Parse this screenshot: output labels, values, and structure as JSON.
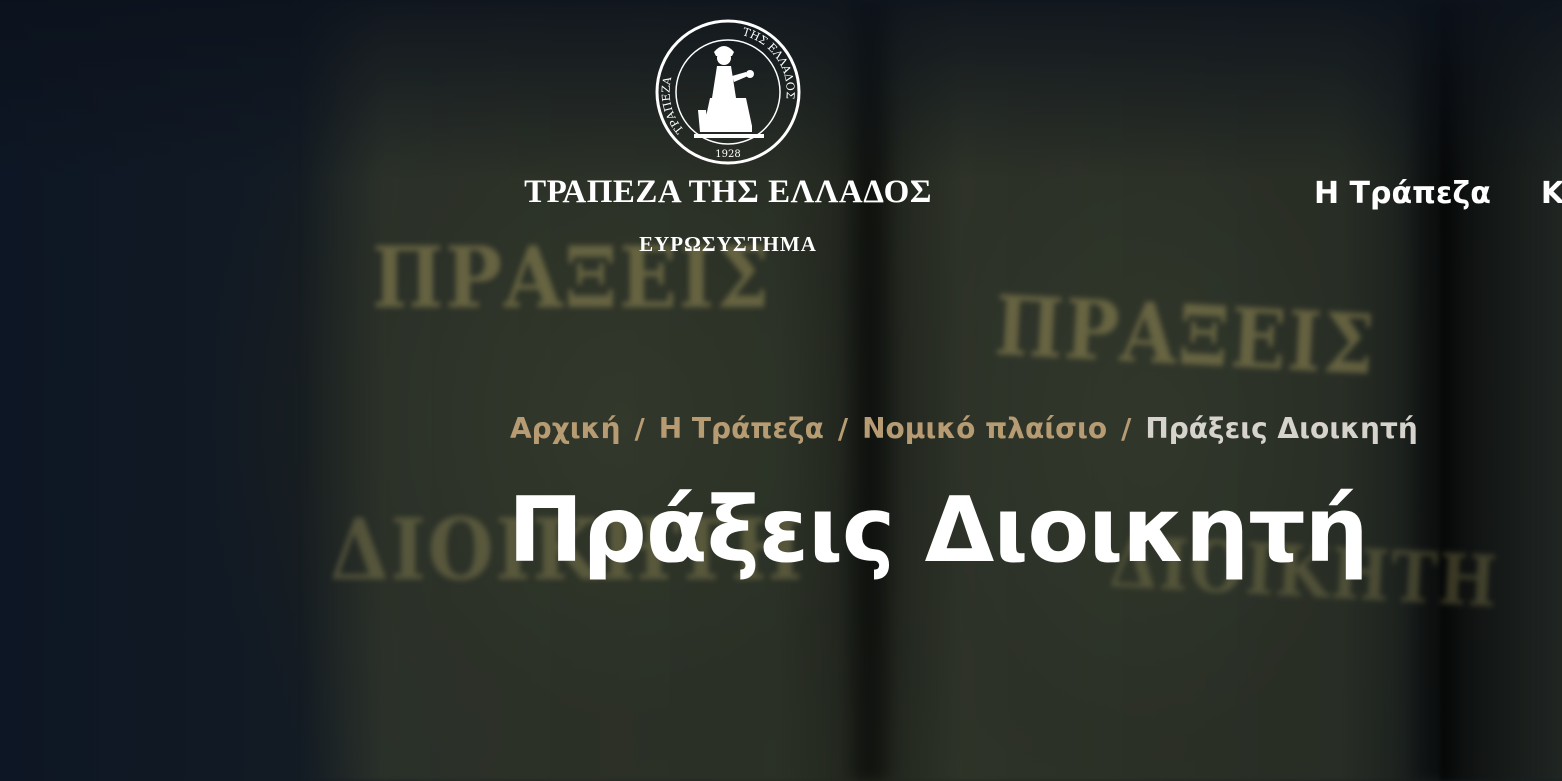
{
  "logo": {
    "title": "ΤΡΑΠΕΖΑ ΤΗΣ ΕΛΛΑΔΟΣ",
    "subtitle": "ΕΥΡΩΣΥΣΤΗΜΑ",
    "seal_text_left": "ΤΡΑΠΕΖΑ",
    "seal_text_right": "ΤΗΣ ΕΛΛΑΔΟΣ",
    "seal_year": "1928"
  },
  "nav": {
    "items": [
      {
        "label": "Η Τράπεζα"
      },
      {
        "label": "Κ"
      }
    ]
  },
  "background": {
    "spine_text_1": "ΠΡΑΞΕΙΣ",
    "spine_text_2": "ΠΡΑΞΕΙΣ",
    "spine_text_3": "ΔΙΟΙΚΗΤΗ",
    "spine_text_4": "ΔΙΟΙΚΗΤΗ"
  },
  "breadcrumb": {
    "items": [
      {
        "label": "Αρχική"
      },
      {
        "label": "Η Τράπεζα"
      },
      {
        "label": "Νομικό πλαίσιο"
      }
    ],
    "current": "Πράξεις Διοικητή",
    "separator": "/"
  },
  "page": {
    "title": "Πράξεις Διοικητή"
  },
  "colors": {
    "breadcrumb_link": "#b79c73",
    "breadcrumb_current": "#d6d3cc",
    "text": "#ffffff"
  }
}
